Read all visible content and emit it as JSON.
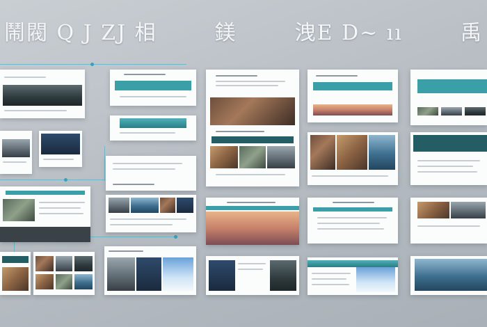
{
  "banner": {
    "segments": [
      "鬧閥 Q J ZJ 相",
      "鎂",
      "洩E D~ ıı",
      "禹"
    ]
  },
  "colors": {
    "accent": "#3a9fa7",
    "accent_dark": "#245d63",
    "connector": "#62b5c9",
    "card": "#fbfcfc"
  }
}
